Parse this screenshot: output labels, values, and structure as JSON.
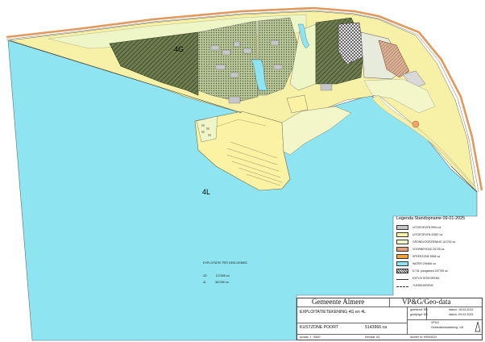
{
  "colors": {
    "water": "#8fe4f2",
    "fill_yellow": "#fbf3a3",
    "fill_pale_green": "#f0f6cc",
    "grey": "#c6c6c6",
    "hatch_dark": "#4a5a30",
    "orange": "#f2a36a",
    "salmon": "#e89a72",
    "road_orange": "#e0985c"
  },
  "map": {
    "area_labels": [
      {
        "id": "4G",
        "text": "4G"
      },
      {
        "id": "4L",
        "text": "4L"
      }
    ]
  },
  "legend": {
    "title": "Legenda Standopname 09-01-2025",
    "items": [
      {
        "color": "#c6c6c6",
        "pattern": "solid",
        "text": "UITGEGEVEN 5964 ca"
      },
      {
        "color": "#fbf3a3",
        "pattern": "solid",
        "text": "UITGEGEVEN 42857 ca"
      },
      {
        "color": "#f0f6cc",
        "pattern": "solid",
        "text": "GRONDVOORZIENING 101702 ca"
      },
      {
        "color": "#e8a07a",
        "pattern": "solid",
        "text": "VOORBEHOUD 26728 ca"
      },
      {
        "color": "#f2a33a",
        "pattern": "solid",
        "text": "SPEERZONE 5908 ca"
      },
      {
        "color": "#8fe4f2",
        "pattern": "solid",
        "text": "WATER 294466 ca"
      },
      {
        "color": "#ffffff",
        "pattern": "hatch",
        "text": "N.T.B. plangebied 187759 ca"
      },
      {
        "color": "#ffffff",
        "pattern": "line",
        "text": "EXPLOITATIEGRENS"
      },
      {
        "color": "#ffffff",
        "pattern": "line2",
        "text": "TUSSENGRENS"
      }
    ]
  },
  "summary": {
    "title": "EXPLOITATIE PER DEELGEBIED",
    "rows": [
      {
        "label": "4G",
        "value": "127555 ca"
      },
      {
        "label": "4L",
        "value": "387399 ca"
      }
    ]
  },
  "title_block": {
    "org_name": "Gemeente Almere",
    "dept": "VP&G/Geo-data",
    "meta": [
      {
        "k": "getekend:",
        "v": "RB",
        "dk": "datum:",
        "dv": "18-03-2019"
      },
      {
        "k": "gewijzigd:",
        "v": "MK",
        "dk": "datum:",
        "dv": "09-02-2025"
      }
    ],
    "unit_line1": "VP&G",
    "unit_line2": "Gebiedsontwikkeling: 1/8",
    "drawing_title": "EXPLOITATIETEKENING 4G en 4L",
    "location": "KUSTZONE POORT",
    "area_total": "5143966 ca",
    "scale_label": "schaal",
    "scale": "1 : 6500",
    "format_label": "formaat:",
    "format": "A3",
    "archive_label": "archief nr:",
    "archive": "99094023"
  }
}
